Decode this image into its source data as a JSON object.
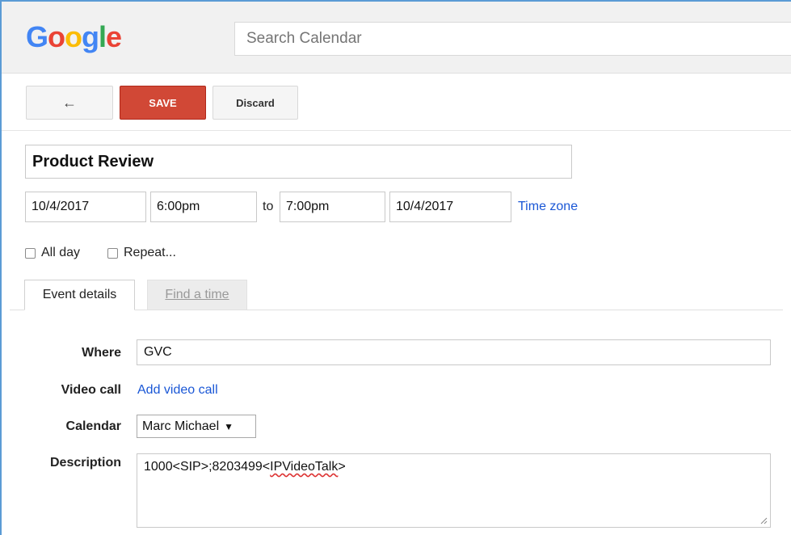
{
  "header": {
    "logo_letters": [
      "G",
      "o",
      "o",
      "g",
      "l",
      "e"
    ],
    "search_placeholder": "Search Calendar"
  },
  "toolbar": {
    "back_icon": "←",
    "save_label": "SAVE",
    "discard_label": "Discard"
  },
  "event": {
    "title": "Product Review",
    "start_date": "10/4/2017",
    "start_time": "6:00pm",
    "to_label": "to",
    "end_time": "7:00pm",
    "end_date": "10/4/2017",
    "time_zone_label": "Time zone",
    "all_day_label": "All day",
    "repeat_label": "Repeat..."
  },
  "tabs": {
    "event_details": "Event details",
    "find_a_time": "Find a time"
  },
  "details": {
    "where_label": "Where",
    "where_value": "GVC",
    "video_call_label": "Video call",
    "video_call_link": "Add video call",
    "calendar_label": "Calendar",
    "calendar_value": "Marc Michael",
    "description_label": "Description",
    "description_prefix": "1000<SIP>;8203499<",
    "description_flagged": "IPVideoTalk",
    "description_suffix": ">"
  },
  "colors": {
    "save_button": "#d14836",
    "link": "#1a57d6",
    "frame": "#5b9bd5"
  }
}
